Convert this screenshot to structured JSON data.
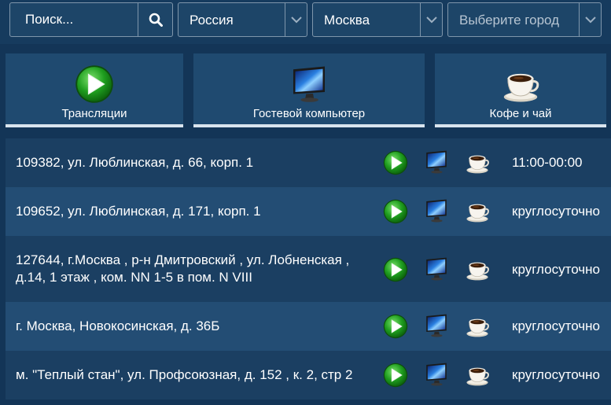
{
  "search": {
    "placeholder": "Поиск..."
  },
  "filters": {
    "country": "Россия",
    "city": "Москва",
    "city2_placeholder": "Выберите город"
  },
  "tiles": [
    {
      "label": "Трансляции",
      "icon": "play-icon"
    },
    {
      "label": "Гостевой компьютер",
      "icon": "monitor-icon"
    },
    {
      "label": "Кофе и чай",
      "icon": "coffee-cup-icon"
    }
  ],
  "colors": {
    "background": "#133557",
    "row_dark": "#1b3f62",
    "row_light": "#234d74",
    "play_green": "#2fb52f"
  },
  "locations": [
    {
      "address": "109382, ул. Люблинская, д. 66, корп. 1",
      "hours": "11:00-00:00"
    },
    {
      "address": "109652, ул. Люблинская, д. 171, корп. 1",
      "hours": "круглосуточно"
    },
    {
      "address": "127644, г.Москва , р-н Дмитровский , ул. Лобненская , д.14, 1 этаж , ком. NN 1-5 в пом. N VIII",
      "hours": "круглосуточно"
    },
    {
      "address": "г. Москва, Новокосинская, д. 36Б",
      "hours": "круглосуточно"
    },
    {
      "address": "м. \"Теплый стан\", ул. Профсоюзная, д. 152 , к. 2, стр 2",
      "hours": "круглосуточно"
    }
  ]
}
